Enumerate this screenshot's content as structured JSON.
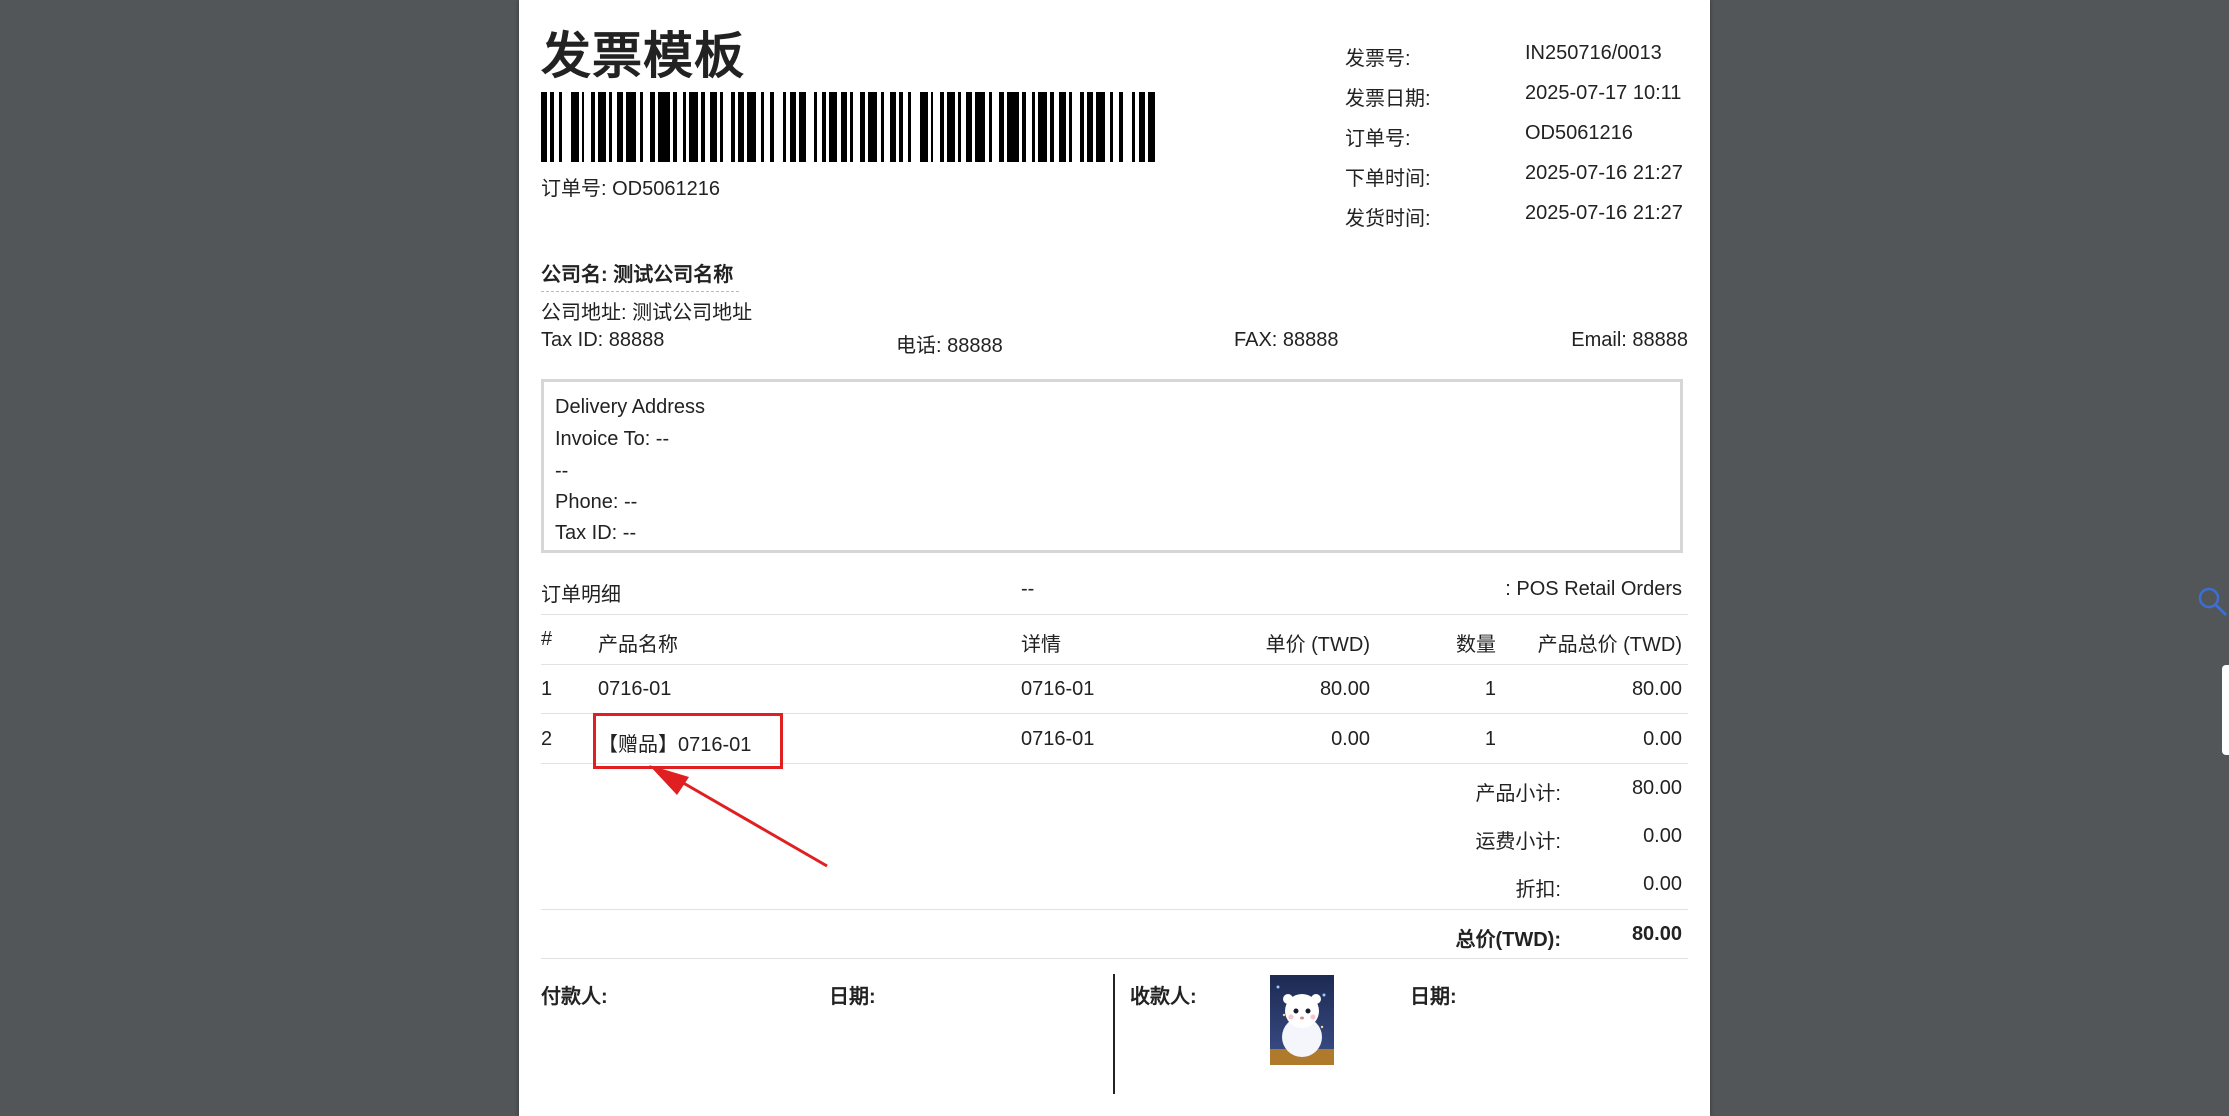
{
  "document": {
    "title": "发票模板",
    "barcode_caption": "订单号: OD5061216"
  },
  "meta": [
    {
      "label": "发票号:",
      "value": "IN250716/0013"
    },
    {
      "label": "发票日期:",
      "value": "2025-07-17 10:11"
    },
    {
      "label": "订单号:",
      "value": "OD5061216"
    },
    {
      "label": "下单时间:",
      "value": "2025-07-16 21:27"
    },
    {
      "label": "发货时间:",
      "value": "2025-07-16 21:27"
    }
  ],
  "company": {
    "name": "公司名: 测试公司名称",
    "address": "公司地址: 测试公司地址",
    "tax_id": "Tax ID: 88888",
    "phone": "电话: 88888",
    "fax": "FAX: 88888",
    "email": "Email: 88888"
  },
  "delivery": {
    "heading": "Delivery Address",
    "invoice_to": "Invoice To: --",
    "line": "--",
    "phone": "Phone: --",
    "tax_id": "Tax ID: --"
  },
  "order": {
    "label": "订单明细",
    "middle": "--",
    "source": ": POS Retail Orders"
  },
  "table": {
    "headers": {
      "index": "#",
      "name": "产品名称",
      "detail": "详情",
      "unit_price": "单价 (TWD)",
      "qty": "数量",
      "total": "产品总价 (TWD)"
    },
    "rows": [
      {
        "index": "1",
        "name": "0716-01",
        "detail": "0716-01",
        "unit_price": "80.00",
        "qty": "1",
        "total": "80.00"
      },
      {
        "index": "2",
        "name": "【赠品】0716-01",
        "detail": "0716-01",
        "unit_price": "0.00",
        "qty": "1",
        "total": "0.00"
      }
    ]
  },
  "summary": {
    "subtotal_label": "产品小计:",
    "subtotal": "80.00",
    "shipping_label": "运费小计:",
    "shipping": "0.00",
    "discount_label": "折扣:",
    "discount": "0.00",
    "total_label": "总价(TWD):",
    "total": "80.00"
  },
  "signature": {
    "payer": "付款人:",
    "payer_date": "日期:",
    "payee": "收款人:",
    "payee_date": "日期:"
  },
  "colors": {
    "background": "#525659",
    "paper": "#ffffff",
    "highlight": "#e02020",
    "search_icon": "#3b6fd6"
  },
  "icons": {
    "search": "search-icon",
    "arrow": "annotation-arrow-icon"
  }
}
